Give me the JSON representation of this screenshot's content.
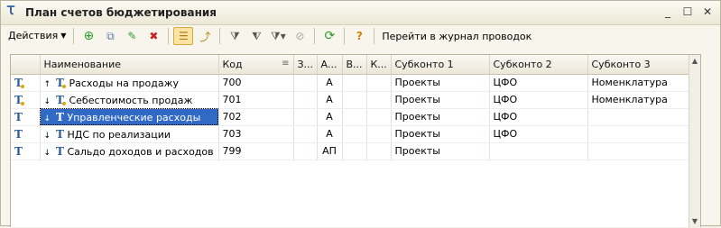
{
  "window": {
    "title": "План счетов бюджетирования",
    "title_icon": "chart-of-accounts-icon",
    "buttons": [
      "minimize-icon",
      "maximize-icon",
      "close-icon"
    ]
  },
  "toolbar": {
    "actions_label": "Действия",
    "icons": [
      "add-icon",
      "copy-icon",
      "edit-icon",
      "delete-icon",
      "hierarchy-icon",
      "level-up-icon",
      "filter-icon",
      "filter-by-value-icon",
      "filter-history-icon",
      "clear-filter-icon",
      "refresh-icon",
      "help-icon"
    ],
    "journal_link": "Перейти в журнал проводок"
  },
  "grid": {
    "columns": [
      "",
      "Наименование",
      "Код",
      "З...",
      "А...",
      "В...",
      "К...",
      "Субконто 1",
      "Субконто 2",
      "Субконто 3"
    ],
    "rows": [
      {
        "name": "Расходы на продажу",
        "code": "700",
        "z": "",
        "a": "А",
        "v": "",
        "k": "",
        "s1": "Проекты",
        "s2": "ЦФО",
        "s3": "Номенклатура",
        "expander": "↑"
      },
      {
        "name": "Себестоимость продаж",
        "code": "701",
        "z": "",
        "a": "А",
        "v": "",
        "k": "",
        "s1": "Проекты",
        "s2": "ЦФО",
        "s3": "Номенклатура",
        "expander": "↓"
      },
      {
        "name": "Управленческие расходы",
        "code": "702",
        "z": "",
        "a": "А",
        "v": "",
        "k": "",
        "s1": "Проекты",
        "s2": "ЦФО",
        "s3": "",
        "expander": "↓"
      },
      {
        "name": "НДС по реализации",
        "code": "703",
        "z": "",
        "a": "А",
        "v": "",
        "k": "",
        "s1": "Проекты",
        "s2": "ЦФО",
        "s3": "",
        "expander": "↓"
      },
      {
        "name": "Сальдо доходов и расходов",
        "code": "799",
        "z": "",
        "a": "АП",
        "v": "",
        "k": "",
        "s1": "Проекты",
        "s2": "",
        "s3": "",
        "expander": "↓"
      }
    ],
    "selected_row": 2
  }
}
